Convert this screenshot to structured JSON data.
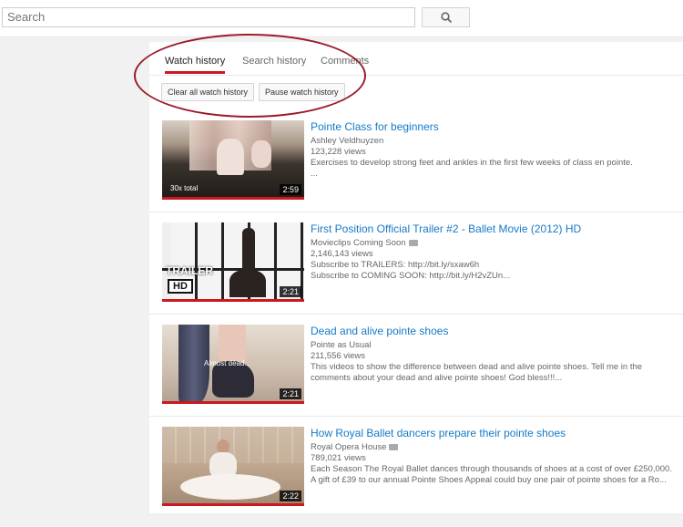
{
  "search": {
    "placeholder": "Search"
  },
  "tabs": [
    "Watch history",
    "Search history",
    "Comments"
  ],
  "actions": {
    "clear": "Clear all watch history",
    "pause": "Pause watch history"
  },
  "videos": [
    {
      "title": "Pointe Class for beginners",
      "channel": "Ashley Veldhuyzen",
      "views": "123,228 views",
      "desc1": "Exercises to develop strong feet and ankles in the first few weeks of class en pointe.",
      "desc2": "...",
      "duration": "2:59",
      "overlay": "30x total"
    },
    {
      "title": "First Position Official Trailer #2 - Ballet Movie (2012) HD",
      "channel": "Movieclips Coming Soon",
      "views": "2,146,143 views",
      "desc1": "Subscribe to TRAILERS: http://bit.ly/sxaw6h",
      "desc2": "Subscribe to COMING SOON: http://bit.ly/H2vZUn...",
      "duration": "2:21",
      "overlay1": "TRAILER",
      "overlay2": "HD"
    },
    {
      "title": "Dead and alive pointe shoes",
      "channel": "Pointe as Usual",
      "views": "211,556 views",
      "desc1": "This videos to show the difference between dead and alive pointe shoes. Tell me in the",
      "desc2": "comments about your dead and alive pointe shoes! God bless!!!...",
      "duration": "2:21",
      "overlay": "Almost dead..."
    },
    {
      "title": "How Royal Ballet dancers prepare their pointe shoes",
      "channel": "Royal Opera House",
      "views": "789,021 views",
      "desc1": "Each Season The Royal Ballet dances through thousands of shoes at a cost of over £250,000.",
      "desc2": "A gift of £39 to our annual Pointe Shoes Appeal could buy one pair of pointe shoes for a Ro...",
      "duration": "2:22"
    }
  ]
}
